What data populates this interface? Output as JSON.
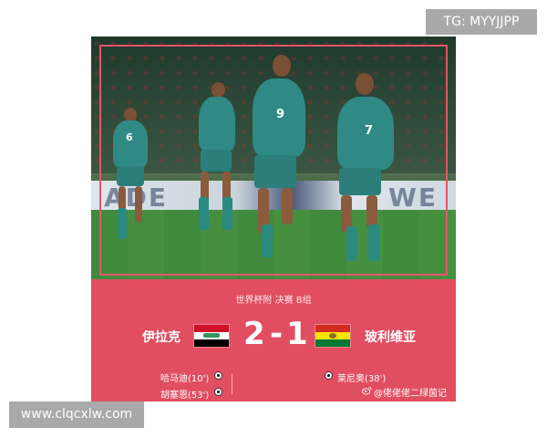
{
  "watermarks": {
    "top": "TG: MYYJJPP",
    "bottom": "www.clqcxlw.com"
  },
  "photo": {
    "board_text_left": "ADE",
    "board_text_right": "WE",
    "players": [
      {
        "number": "6"
      },
      {
        "number": "9"
      },
      {
        "number": "7"
      }
    ]
  },
  "match": {
    "stage": "世界杯附  决赛  B组",
    "home_team": "伊拉克",
    "away_team": "玻利维亚",
    "home_score": "2",
    "separator": "-",
    "away_score": "1",
    "home_scorers": [
      "哈马迪(10')",
      "胡塞恩(53')"
    ],
    "away_scorers": [
      "莱尼奥(38')"
    ]
  },
  "credit": "@佬佬佬二绿茵记",
  "colors": {
    "panel": "#e14e62",
    "frame": "#e8546a",
    "iraq_flag": [
      "#ce1126",
      "#ffffff",
      "#000000"
    ],
    "bolivia_flag": [
      "#d52b1e",
      "#f9e300",
      "#007934"
    ]
  }
}
